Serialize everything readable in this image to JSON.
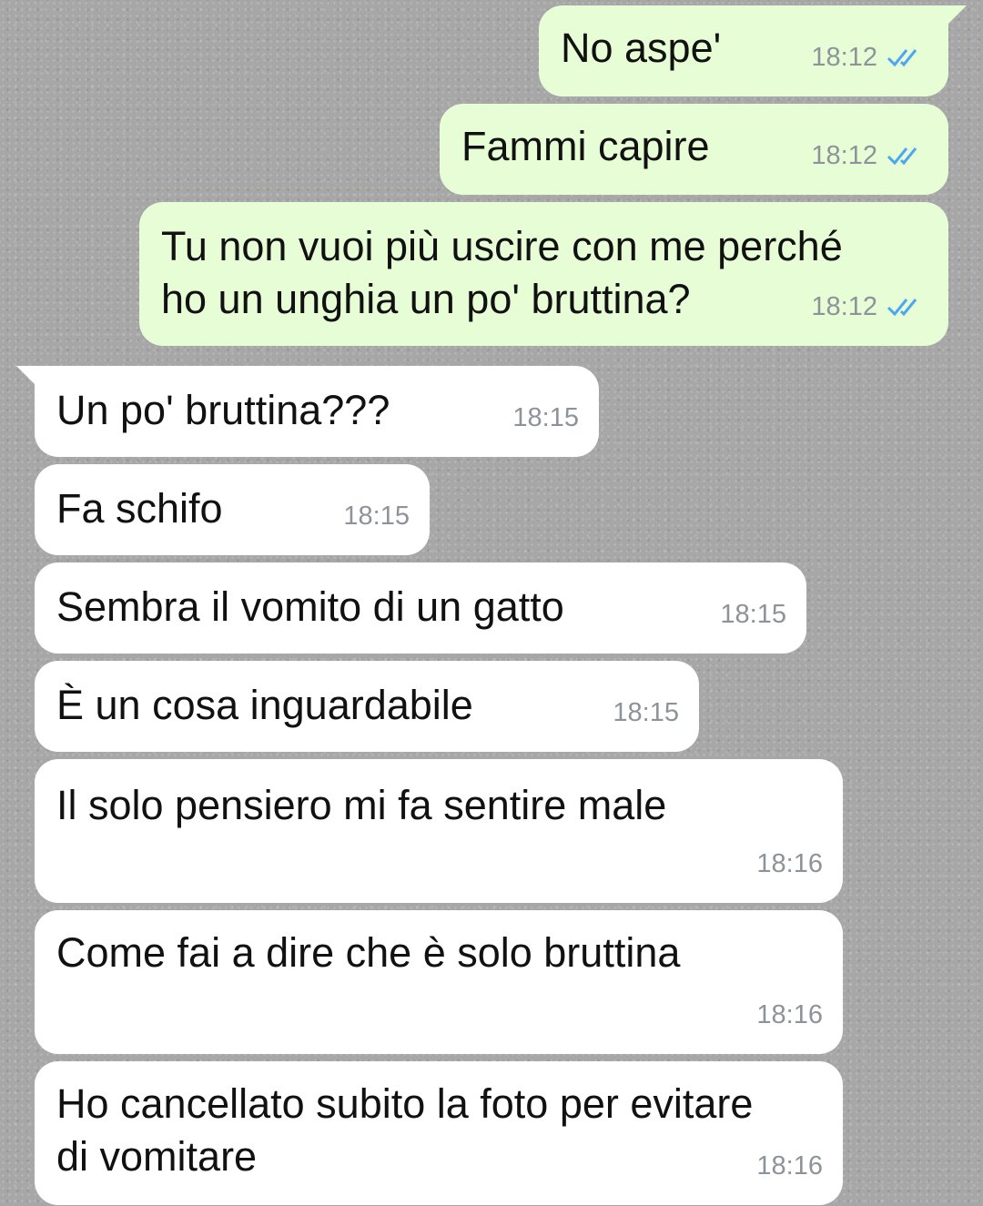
{
  "colors": {
    "outgoing_bubble": "#e6fdd6",
    "incoming_bubble": "#ffffff",
    "read_ticks": "#4fa6f0",
    "timestamp": "#8e9399"
  },
  "messages": [
    {
      "direction": "out",
      "text": "No aspe'",
      "time": "18:12",
      "status_icon": "double-check-read-icon"
    },
    {
      "direction": "out",
      "text": "Fammi capire",
      "time": "18:12",
      "status_icon": "double-check-read-icon"
    },
    {
      "direction": "out",
      "text": "Tu non vuoi più uscire con me perché\nho un unghia un po' bruttina?",
      "time": "18:12",
      "status_icon": "double-check-read-icon"
    },
    {
      "direction": "in",
      "text": "Un po' bruttina???",
      "time": "18:15"
    },
    {
      "direction": "in",
      "text": "Fa schifo",
      "time": "18:15"
    },
    {
      "direction": "in",
      "text": "Sembra il vomito di un gatto",
      "time": "18:15"
    },
    {
      "direction": "in",
      "text": "È un cosa inguardabile",
      "time": "18:15"
    },
    {
      "direction": "in",
      "text": "Il solo pensiero mi fa sentire male",
      "time": "18:16"
    },
    {
      "direction": "in",
      "text": "Come fai a dire che è solo bruttina",
      "time": "18:16"
    },
    {
      "direction": "in",
      "text": "Ho cancellato subito la foto per evitare\ndi vomitare",
      "time": "18:16"
    }
  ]
}
